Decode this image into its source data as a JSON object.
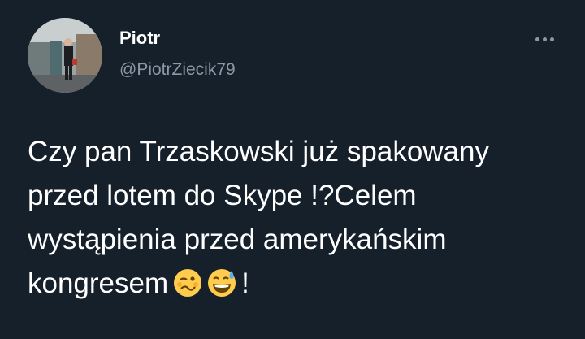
{
  "user": {
    "name": "Piotr",
    "handle": "@PiotrZiecik79"
  },
  "menu": {
    "icon": "more-horizontal-icon"
  },
  "tweet": {
    "lines": [
      "Czy pan Trzaskowski już spakowany",
      "przed lotem do Skype !?Celem",
      "wystąpienia przed amerykańskim",
      "kongresem"
    ],
    "end": "!",
    "emojis": [
      "woozy-face-emoji",
      "grinning-face-with-sweat-emoji"
    ]
  },
  "colors": {
    "background": "#15202b",
    "text": "#ffffff",
    "secondary": "#8b98a5"
  }
}
